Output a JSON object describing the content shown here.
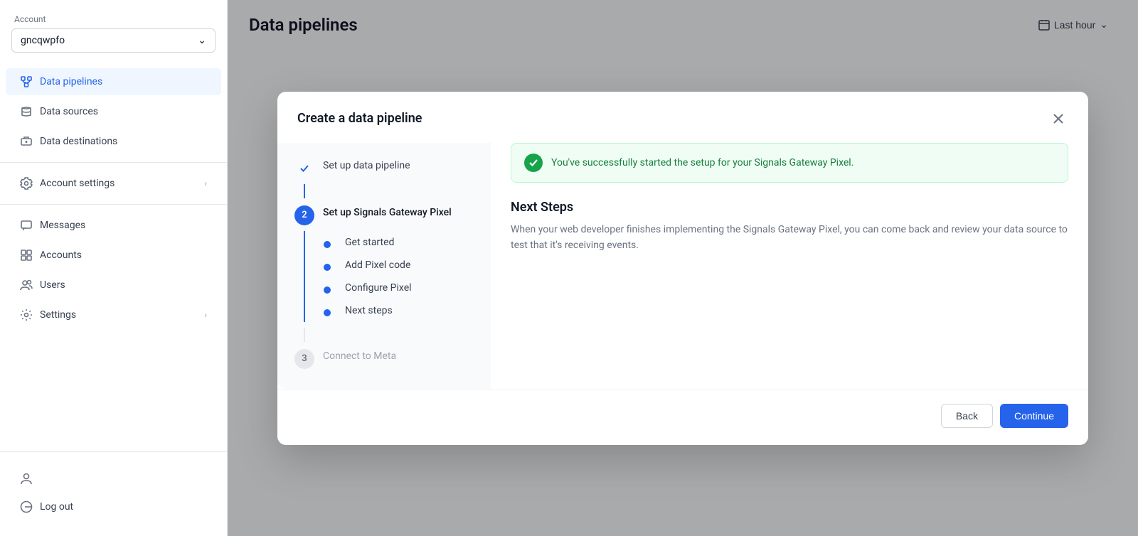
{
  "sidebar": {
    "account_label": "Account",
    "account_name": "gncqwpfo",
    "nav_items": [
      {
        "id": "data-pipelines",
        "label": "Data pipelines",
        "active": true,
        "icon": "data-pipeline-icon"
      },
      {
        "id": "data-sources",
        "label": "Data sources",
        "active": false,
        "icon": "data-source-icon"
      },
      {
        "id": "data-destinations",
        "label": "Data destinations",
        "active": false,
        "icon": "data-dest-icon"
      },
      {
        "id": "account-settings",
        "label": "Account settings",
        "active": false,
        "icon": "settings-icon",
        "chevron": true
      },
      {
        "id": "messages",
        "label": "Messages",
        "active": false,
        "icon": "message-icon"
      },
      {
        "id": "accounts",
        "label": "Accounts",
        "active": false,
        "icon": "accounts-icon"
      },
      {
        "id": "users",
        "label": "Users",
        "active": false,
        "icon": "users-icon"
      },
      {
        "id": "settings",
        "label": "Settings",
        "active": false,
        "icon": "gear-icon",
        "chevron": true
      }
    ],
    "bottom_items": [
      {
        "id": "profile",
        "label": "",
        "icon": "profile-icon"
      },
      {
        "id": "logout",
        "label": "Log out",
        "icon": "logout-icon"
      }
    ]
  },
  "header": {
    "title": "Data pipelines",
    "time_filter": "Last hour"
  },
  "modal": {
    "title": "Create a data pipeline",
    "close_label": "×",
    "steps": [
      {
        "id": "step-1",
        "number": "✓",
        "label": "Set up data pipeline",
        "status": "completed"
      },
      {
        "id": "step-2",
        "number": "2",
        "label": "Set up Signals Gateway Pixel",
        "status": "active",
        "substeps": [
          {
            "id": "substep-1",
            "label": "Get started"
          },
          {
            "id": "substep-2",
            "label": "Add Pixel code"
          },
          {
            "id": "substep-3",
            "label": "Configure Pixel"
          },
          {
            "id": "substep-4",
            "label": "Next steps"
          }
        ]
      },
      {
        "id": "step-3",
        "number": "3",
        "label": "Connect to Meta",
        "status": "pending"
      }
    ],
    "success_message": "You've successfully started the setup for your Signals Gateway Pixel.",
    "next_steps_title": "Next Steps",
    "next_steps_desc": "When your web developer finishes implementing the Signals Gateway Pixel, you can come back and review your data source to test that it's receiving events.",
    "back_label": "Back",
    "continue_label": "Continue"
  }
}
